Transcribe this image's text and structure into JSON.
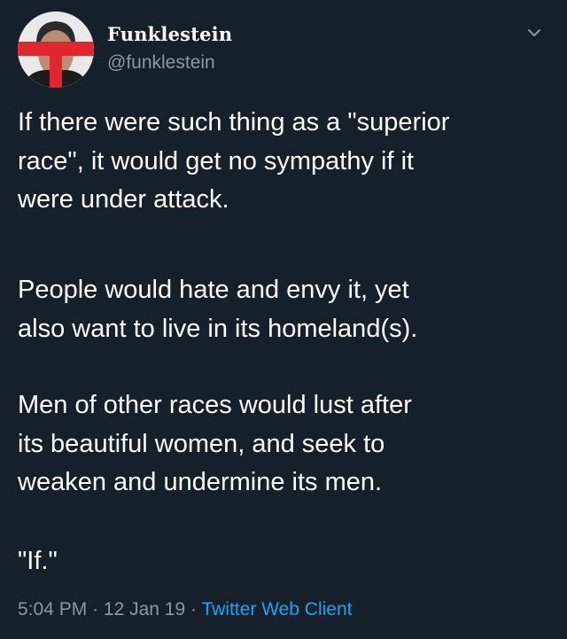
{
  "tweet": {
    "author": {
      "display_name": "Funklestein",
      "handle": "@funklestein"
    },
    "paragraphs": [
      "If there were such thing as a \"superior\nrace\", it would get no sympathy if it\nwere under attack.",
      "People would hate and envy it, yet\nalso want to live in its homeland(s).",
      "Men of other races would lust after\nits beautiful women, and seek to\nweaken and undermine its men.",
      "\"If.\""
    ],
    "meta": {
      "time": "5:04 PM",
      "separator": "·",
      "date": "12 Jan 19",
      "client": "Twitter Web Client"
    }
  },
  "colors": {
    "background": "#15202b",
    "text_primary": "#ffffff",
    "text_secondary": "#8899a6",
    "link": "#1da1f2"
  },
  "icons": {
    "menu": "chevron-down-icon"
  }
}
